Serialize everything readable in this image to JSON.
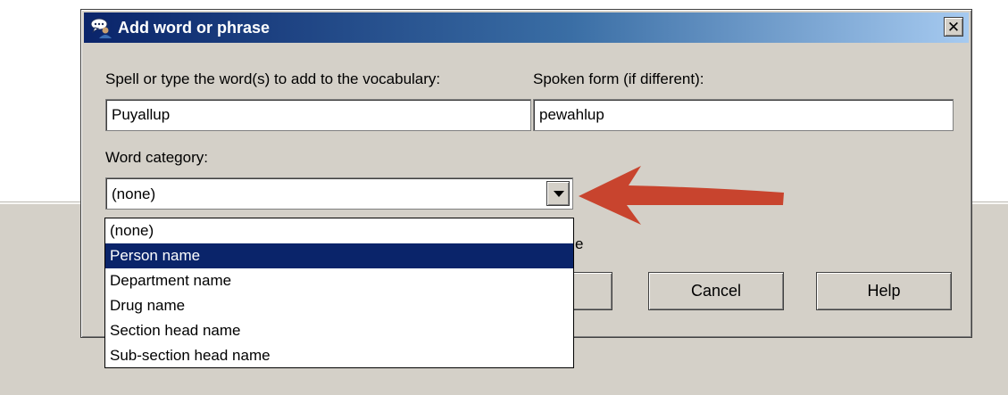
{
  "dialog": {
    "title": "Add word or phrase",
    "close_glyph": "✕",
    "spell_label": "Spell or type the word(s) to add to the vocabulary:",
    "spell_value": "Puyallup",
    "spoken_label": "Spoken form (if different):",
    "spoken_value": "pewahlup",
    "category_label": "Word category:",
    "category_value": "(none)",
    "hidden_option_fragment": "e",
    "cancel_label": "Cancel",
    "help_label": "Help"
  },
  "dropdown": {
    "options": [
      "(none)",
      "Person name",
      "Department name",
      "Drug name",
      "Section head name",
      "Sub-section head name"
    ],
    "highlighted_index": 1
  },
  "icons": {
    "title": "speech-user-icon",
    "close": "close-icon",
    "combo": "chevron-down-icon",
    "annotation": "red-arrow-icon"
  },
  "colors": {
    "title_gradient_start": "#0a246a",
    "title_gradient_end": "#a6caf0",
    "selection": "#0a246a",
    "annotation_arrow": "#c8442e"
  }
}
